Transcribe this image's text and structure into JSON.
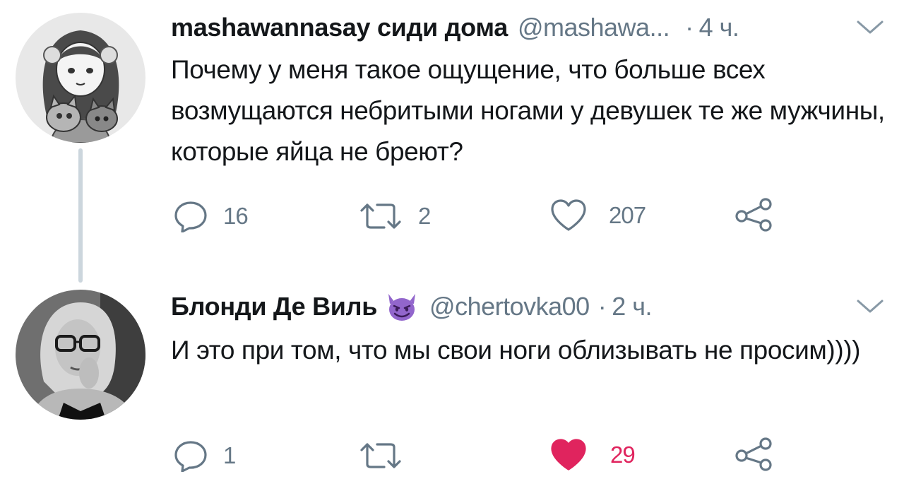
{
  "tweets": [
    {
      "author": "mashawannasay сиди дома",
      "handle": "@mashawa...",
      "separator": "·",
      "time": "4 ч.",
      "avatar_icon": "drawn-girl-with-cats-avatar",
      "text": "Почему у меня такое ощущение, что больше всех возмущаются небритыми ногами у девушек те же мужчины, которые яйца не бреют?",
      "actions": {
        "replies": "16",
        "retweets": "2",
        "likes": "207",
        "liked": false
      }
    },
    {
      "author": "Блонди Де Виль",
      "author_emoji": "smiling-devil-emoji",
      "handle": "@chertovka00",
      "separator": "·",
      "time": "2 ч.",
      "avatar_icon": "blonde-woman-with-glasses-photo",
      "text": "И это при том, что мы свои ноги облизывать не просим))))",
      "actions": {
        "replies": "1",
        "retweets": "",
        "likes": "29",
        "liked": true
      }
    }
  ],
  "colors": {
    "text": "#14171a",
    "secondary": "#657786",
    "thread_line": "#ccd6dd",
    "like_active": "#e0245e",
    "emoji_purple": "#9266cc"
  }
}
